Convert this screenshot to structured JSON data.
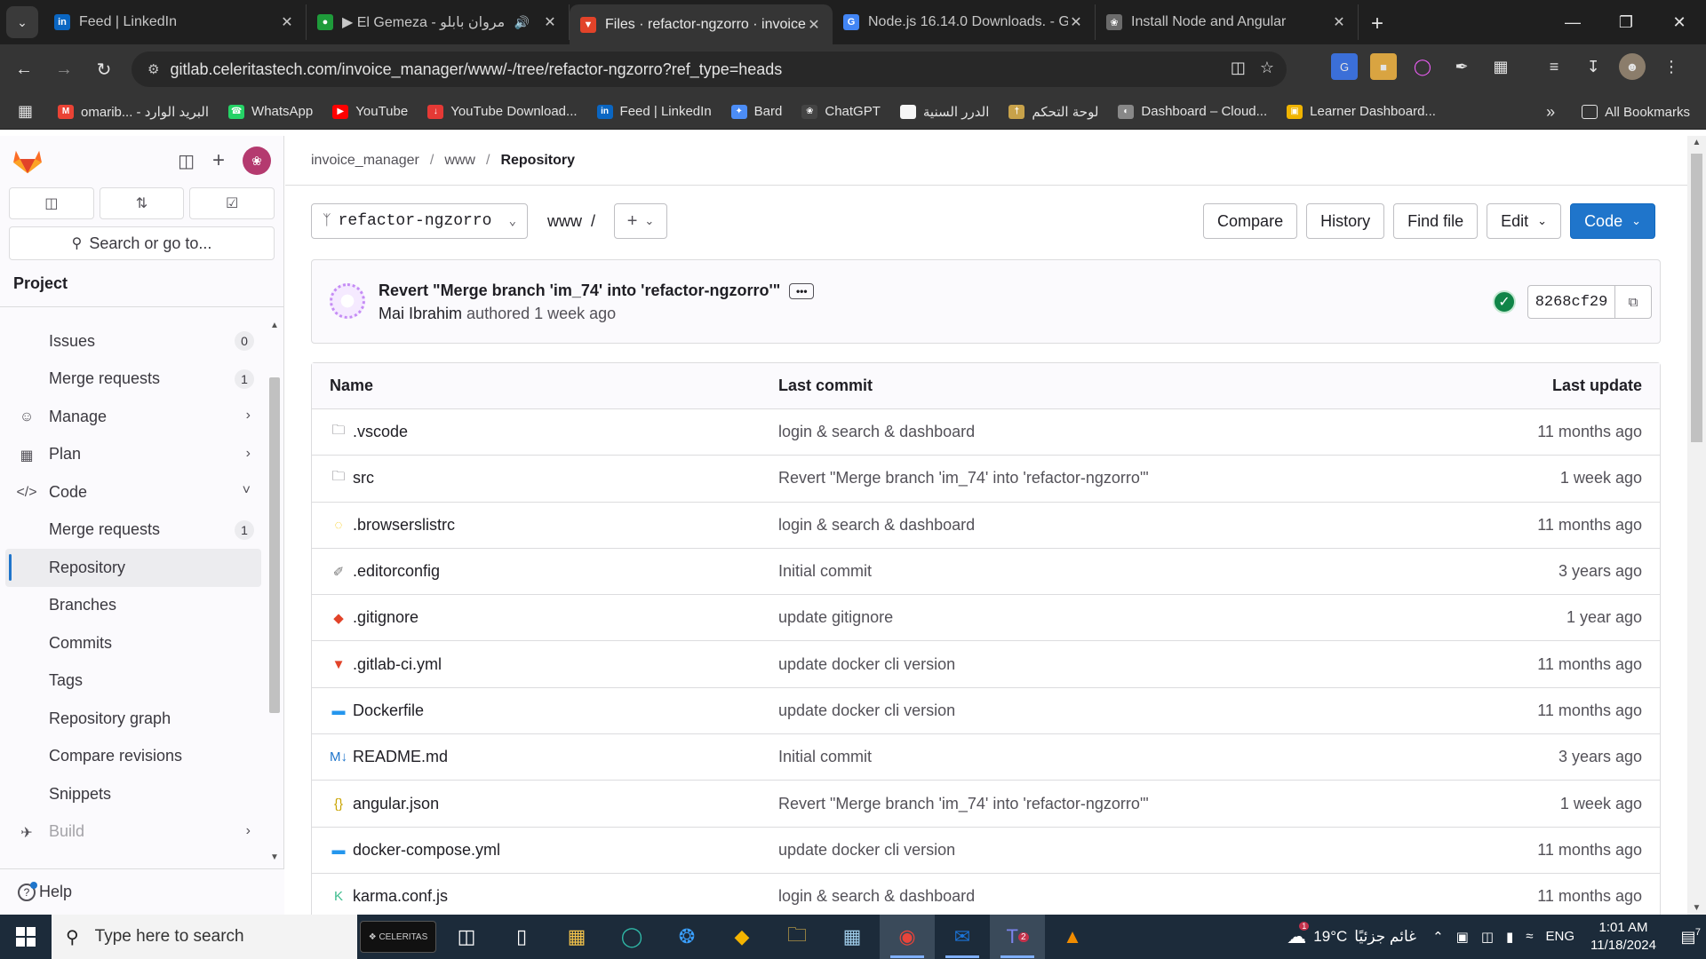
{
  "browser": {
    "tabs": [
      {
        "title": "Feed | LinkedIn",
        "icon": "linkedin-icon",
        "color": "#0a66c2",
        "glyph": "in",
        "active": false
      },
      {
        "title": "▶ El Gemeza - مروان بابلو",
        "icon": "audio-site-icon",
        "color": "#1e9b3a",
        "glyph": "●",
        "active": false,
        "audio": true
      },
      {
        "title": "Files · refactor-ngzorro · invoice",
        "icon": "gitlab-tab-icon",
        "color": "#e24329",
        "glyph": "▼",
        "active": true
      },
      {
        "title": "Node.js 16.14.0 Downloads. - G",
        "icon": "google-icon",
        "color": "#4285f4",
        "glyph": "G",
        "active": false
      },
      {
        "title": "Install Node and Angular",
        "icon": "chatgpt-tab-icon",
        "color": "#6b6b6b",
        "glyph": "❀",
        "active": false
      }
    ],
    "url_host": "gitlab.celeritastech.com",
    "url_path": "/invoice_manager/www/-/tree/refactor-ngzorro?ref_type=heads",
    "bookmarks": [
      {
        "label": "omarib... - البريد الوارد",
        "color": "#ea4335",
        "glyph": "M"
      },
      {
        "label": "WhatsApp",
        "color": "#25d366",
        "glyph": "☎"
      },
      {
        "label": "YouTube",
        "color": "#ff0000",
        "glyph": "▶"
      },
      {
        "label": "YouTube Download...",
        "color": "#e53935",
        "glyph": "↓"
      },
      {
        "label": "Feed | LinkedIn",
        "color": "#0a66c2",
        "glyph": "in"
      },
      {
        "label": "Bard",
        "color": "#4c8df6",
        "glyph": "✦"
      },
      {
        "label": "ChatGPT",
        "color": "#444",
        "glyph": "❀"
      },
      {
        "label": "الدرر السنية",
        "color": "#f5f5f5",
        "glyph": ""
      },
      {
        "label": "لوحة التحكم",
        "color": "#c8a24a",
        "glyph": "†"
      },
      {
        "label": "Dashboard – Cloud...",
        "color": "#888",
        "glyph": "◐"
      },
      {
        "label": "Learner Dashboard...",
        "color": "#f0b400",
        "glyph": "▣"
      }
    ],
    "all_bookmarks": "All Bookmarks"
  },
  "sidebar": {
    "search_placeholder": "Search or go to...",
    "section": "Project",
    "items": [
      {
        "label": "Issues",
        "badge": "0",
        "type": "sub"
      },
      {
        "label": "Merge requests",
        "badge": "1",
        "type": "sub"
      },
      {
        "label": "Manage",
        "type": "group",
        "icon": "users-icon",
        "glyph": "☺",
        "chevron": "›"
      },
      {
        "label": "Plan",
        "type": "group",
        "icon": "calendar-icon",
        "glyph": "▦",
        "chevron": "›"
      },
      {
        "label": "Code",
        "type": "group",
        "icon": "code-icon",
        "glyph": "</>",
        "chevron": "˅"
      },
      {
        "label": "Merge requests",
        "badge": "1",
        "type": "sub"
      },
      {
        "label": "Repository",
        "type": "sub",
        "active": true
      },
      {
        "label": "Branches",
        "type": "sub"
      },
      {
        "label": "Commits",
        "type": "sub"
      },
      {
        "label": "Tags",
        "type": "sub"
      },
      {
        "label": "Repository graph",
        "type": "sub"
      },
      {
        "label": "Compare revisions",
        "type": "sub"
      },
      {
        "label": "Snippets",
        "type": "sub"
      },
      {
        "label": "Build",
        "type": "group",
        "icon": "rocket-icon",
        "glyph": "✈",
        "chevron": "›",
        "faded": true
      }
    ],
    "help": "Help"
  },
  "main": {
    "breadcrumb": [
      "invoice_manager",
      "www",
      "Repository"
    ],
    "branch": "refactor-ngzorro",
    "path": "www",
    "path_sep": "/",
    "buttons": {
      "compare": "Compare",
      "history": "History",
      "find_file": "Find file",
      "edit": "Edit",
      "code": "Code"
    },
    "commit": {
      "title": "Revert \"Merge branch 'im_74' into 'refactor-ngzorro'\"",
      "author": "Mai Ibrahim",
      "meta": "authored 1 week ago",
      "sha": "8268cf29"
    },
    "table": {
      "headers": {
        "name": "Name",
        "last_commit": "Last commit",
        "last_update": "Last update"
      },
      "rows": [
        {
          "name": ".vscode",
          "icon": "folder-icon",
          "glyph": "🗀",
          "color": "#535158",
          "commit": "login & search & dashboard",
          "updated": "11 months ago"
        },
        {
          "name": "src",
          "icon": "folder-icon",
          "glyph": "🗀",
          "color": "#535158",
          "commit": "Revert \"Merge branch 'im_74' into 'refactor-ngzorro'\"",
          "updated": "1 week ago"
        },
        {
          "name": ".browserslistrc",
          "icon": "browserslist-icon",
          "glyph": "◌",
          "color": "#f7c600",
          "commit": "login & search & dashboard",
          "updated": "11 months ago"
        },
        {
          "name": ".editorconfig",
          "icon": "editorconfig-icon",
          "glyph": "✐",
          "color": "#777",
          "commit": "Initial commit",
          "updated": "3 years ago"
        },
        {
          "name": ".gitignore",
          "icon": "git-icon",
          "glyph": "◆",
          "color": "#e24329",
          "commit": "update gitignore",
          "updated": "1 year ago"
        },
        {
          "name": ".gitlab-ci.yml",
          "icon": "gitlab-icon",
          "glyph": "▼",
          "color": "#e24329",
          "commit": "update docker cli version",
          "updated": "11 months ago"
        },
        {
          "name": "Dockerfile",
          "icon": "docker-icon",
          "glyph": "▬",
          "color": "#2496ed",
          "commit": "update docker cli version",
          "updated": "11 months ago"
        },
        {
          "name": "README.md",
          "icon": "markdown-icon",
          "glyph": "M↓",
          "color": "#1f75cb",
          "commit": "Initial commit",
          "updated": "3 years ago"
        },
        {
          "name": "angular.json",
          "icon": "json-icon",
          "glyph": "{}",
          "color": "#c9a400",
          "commit": "Revert \"Merge branch 'im_74' into 'refactor-ngzorro'\"",
          "updated": "1 week ago"
        },
        {
          "name": "docker-compose.yml",
          "icon": "docker-icon",
          "glyph": "▬",
          "color": "#2496ed",
          "commit": "update docker cli version",
          "updated": "11 months ago"
        },
        {
          "name": "karma.conf.js",
          "icon": "karma-icon",
          "glyph": "K",
          "color": "#3cbc8d",
          "commit": "login & search & dashboard",
          "updated": "11 months ago"
        }
      ]
    }
  },
  "taskbar": {
    "search_placeholder": "Type here to search",
    "temperature": "19°C",
    "weather_text": "غائم جزئيًا",
    "language": "ENG",
    "time": "1:01 AM",
    "date": "11/18/2024",
    "notifications": "7",
    "weather_badge": "1",
    "teams_badge": "2"
  },
  "colors": {
    "accent": "#1f75cb",
    "gitlab_orange": "#e24329",
    "success": "#108548"
  }
}
